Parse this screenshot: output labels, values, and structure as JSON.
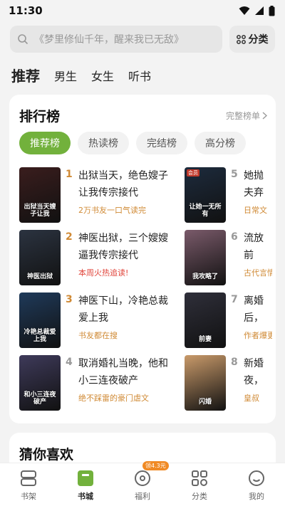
{
  "status_bar": {
    "time": "11:30"
  },
  "search": {
    "placeholder": "《梦里修仙千年，醒来我已无敌》",
    "category_label": "分类"
  },
  "top_tabs": [
    {
      "label": "推荐",
      "active": true
    },
    {
      "label": "男生",
      "active": false
    },
    {
      "label": "女生",
      "active": false
    },
    {
      "label": "听书",
      "active": false
    }
  ],
  "ranking": {
    "title": "排行榜",
    "more_label": "完整榜单",
    "tabs": [
      {
        "label": "推荐榜",
        "active": true
      },
      {
        "label": "热读榜",
        "active": false
      },
      {
        "label": "完结榜",
        "active": false
      },
      {
        "label": "高分榜",
        "active": false
      }
    ],
    "books": [
      {
        "rank": "1",
        "title": "出狱当天，绝色嫂子让我传宗接代",
        "subtitle": "2万书友一口气读完",
        "cover_color": "#3a1d1d",
        "cover_text": "出狱当天嫂子让我"
      },
      {
        "rank": "2",
        "title": "神医出狱，三个嫂嫂逼我传宗接代",
        "subtitle": "本周火热追读!",
        "cover_color": "#2b3340",
        "cover_text": "神医出狱"
      },
      {
        "rank": "3",
        "title": "神医下山，冷艳总裁爱上我",
        "subtitle": "书友都在搜",
        "cover_color": "#1f3a5a",
        "cover_text": "冷艳总裁爱上我"
      },
      {
        "rank": "4",
        "title": "取消婚礼当晚，他和小三连夜破产",
        "subtitle": "绝不踩雷的豪门虐文",
        "cover_color": "#3e3a5a",
        "cover_text": "和小三连夜破产"
      },
      {
        "rank": "5",
        "title": "她抛夫弃子后，让她一无所有",
        "subtitle": "日常文",
        "cover_color": "#1d2b3d",
        "cover_text": "让她一无所有",
        "tag": "会员"
      },
      {
        "rank": "6",
        "title": "流放前夕，我攻略了敌国丞相",
        "subtitle": "古代言情",
        "cover_color": "#7a5a6a",
        "cover_text": "我攻略了"
      },
      {
        "rank": "7",
        "title": "离婚后，前妻的老公后悔了",
        "subtitle": "作者爆更",
        "cover_color": "#2f2f3a",
        "cover_text": "前妻"
      },
      {
        "rank": "8",
        "title": "新婚夜，闪婚老公和绝嗣大佬是同一人",
        "subtitle": "皇叔",
        "cover_color": "#c99a6a",
        "cover_text": "闪婚"
      }
    ]
  },
  "guess": {
    "title": "猜你喜欢"
  },
  "bottom_nav": [
    {
      "label": "书架",
      "icon": "bookshelf-icon",
      "active": false
    },
    {
      "label": "书城",
      "icon": "bookstore-icon",
      "active": true
    },
    {
      "label": "福利",
      "icon": "gift-icon",
      "active": false,
      "badge": "领4.3元"
    },
    {
      "label": "分类",
      "icon": "category-icon",
      "active": false
    },
    {
      "label": "我的",
      "icon": "profile-icon",
      "active": false
    }
  ],
  "colors": {
    "accent": "#72b13c",
    "subtitle": "#d08a35",
    "badge": "#f08a24"
  }
}
